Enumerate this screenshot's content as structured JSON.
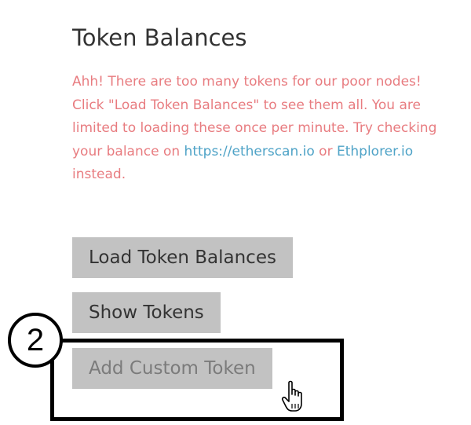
{
  "section": {
    "title": "Token Balances"
  },
  "warning": {
    "text_1": "Ahh! There are too many tokens for our poor nodes! Click \"Load Token Balances\" to see them all. You are limited to loading these once per minute. Try checking your balance on ",
    "link_etherscan": "https://etherscan.io",
    "text_2": " or ",
    "link_ethplorer": "Ethplorer.io",
    "text_3": " instead."
  },
  "buttons": {
    "load_label": "Load Token Balances",
    "show_label": "Show Tokens",
    "add_label": "Add Custom Token"
  },
  "annotation": {
    "step_number": "2"
  },
  "colors": {
    "warning_text": "#e87c80",
    "link": "#4fa3c7",
    "button_bg": "#c2c2c2"
  },
  "icons": {
    "cursor": "hand-pointer-icon"
  }
}
